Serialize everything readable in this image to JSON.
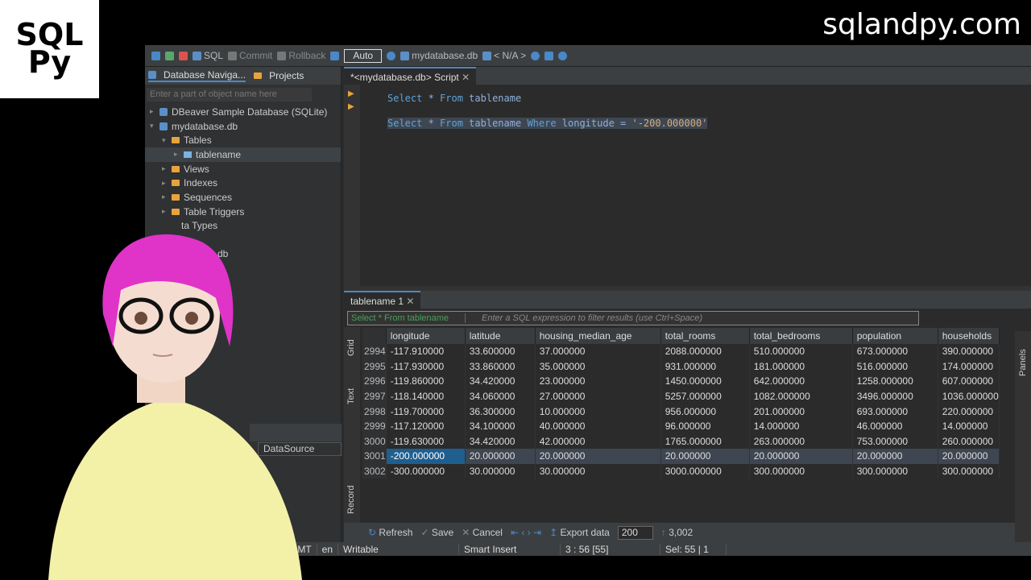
{
  "branding": {
    "logo_line1": "SQL",
    "logo_line2": "Py",
    "site": "sqlandpy.com"
  },
  "toolbar": {
    "sql": "SQL",
    "commit": "Commit",
    "rollback": "Rollback",
    "auto": "Auto",
    "database": "mydatabase.db",
    "schema": "< N/A >"
  },
  "navigator": {
    "tab_db": "Database Naviga...",
    "tab_projects": "Projects",
    "filter_placeholder": "Enter a part of object name here",
    "tree": {
      "sample_db": "DBeaver Sample Database (SQLite)",
      "mydb": "mydatabase.db",
      "tables": "Tables",
      "tablename": "tablename",
      "views": "Views",
      "indexes": "Indexes",
      "sequences": "Sequences",
      "triggers": "Table Triggers",
      "datatypes": "ta Types",
      "db2": "e.db"
    },
    "datasource": "DataSource"
  },
  "editor": {
    "tab": "*<mydatabase.db> Script",
    "line1": {
      "k1": "Select",
      "star": " * ",
      "k2": "From",
      "tbl": " tablename"
    },
    "line2": {
      "k1": "Select",
      "star": " * ",
      "k2": "From",
      "tbl": " tablename ",
      "k3": "Where",
      "col": " longitude = ",
      "val": "'-200.000000'"
    }
  },
  "results": {
    "tab": "tablename 1",
    "filter_left": "Select * From tablename",
    "filter_placeholder": "Enter a SQL expression to filter results (use Ctrl+Space)",
    "side_grid": "Grid",
    "side_text": "Text",
    "side_record": "Record",
    "panels": "Panels",
    "columns": [
      "longitude",
      "latitude",
      "housing_median_age",
      "total_rooms",
      "total_bedrooms",
      "population",
      "households"
    ],
    "rows": [
      {
        "n": "2994",
        "c": [
          "-117.910000",
          "33.600000",
          "37.000000",
          "2088.000000",
          "510.000000",
          "673.000000",
          "390.000000"
        ]
      },
      {
        "n": "2995",
        "c": [
          "-117.930000",
          "33.860000",
          "35.000000",
          "931.000000",
          "181.000000",
          "516.000000",
          "174.000000"
        ]
      },
      {
        "n": "2996",
        "c": [
          "-119.860000",
          "34.420000",
          "23.000000",
          "1450.000000",
          "642.000000",
          "1258.000000",
          "607.000000"
        ]
      },
      {
        "n": "2997",
        "c": [
          "-118.140000",
          "34.060000",
          "27.000000",
          "5257.000000",
          "1082.000000",
          "3496.000000",
          "1036.000000"
        ]
      },
      {
        "n": "2998",
        "c": [
          "-119.700000",
          "36.300000",
          "10.000000",
          "956.000000",
          "201.000000",
          "693.000000",
          "220.000000"
        ]
      },
      {
        "n": "2999",
        "c": [
          "-117.120000",
          "34.100000",
          "40.000000",
          "96.000000",
          "14.000000",
          "46.000000",
          "14.000000"
        ]
      },
      {
        "n": "3000",
        "c": [
          "-119.630000",
          "34.420000",
          "42.000000",
          "1765.000000",
          "263.000000",
          "753.000000",
          "260.000000"
        ]
      },
      {
        "n": "3001",
        "c": [
          "-200.000000",
          "20.000000",
          "20.000000",
          "20.000000",
          "20.000000",
          "20.000000",
          "20.000000"
        ]
      },
      {
        "n": "3002",
        "c": [
          "-300.000000",
          "30.000000",
          "30.000000",
          "3000.000000",
          "300.000000",
          "300.000000",
          "300.000000"
        ]
      }
    ],
    "bottom": {
      "refresh": "Refresh",
      "save": "Save",
      "cancel": "Cancel",
      "export": "Export data",
      "fetch_size": "200",
      "row_count": "3,002"
    }
  },
  "status": {
    "tz": "GMT",
    "lang": "en",
    "mode": "Writable",
    "insert": "Smart Insert",
    "pos": "3 : 56 [55]",
    "sel": "Sel: 55 | 1"
  }
}
